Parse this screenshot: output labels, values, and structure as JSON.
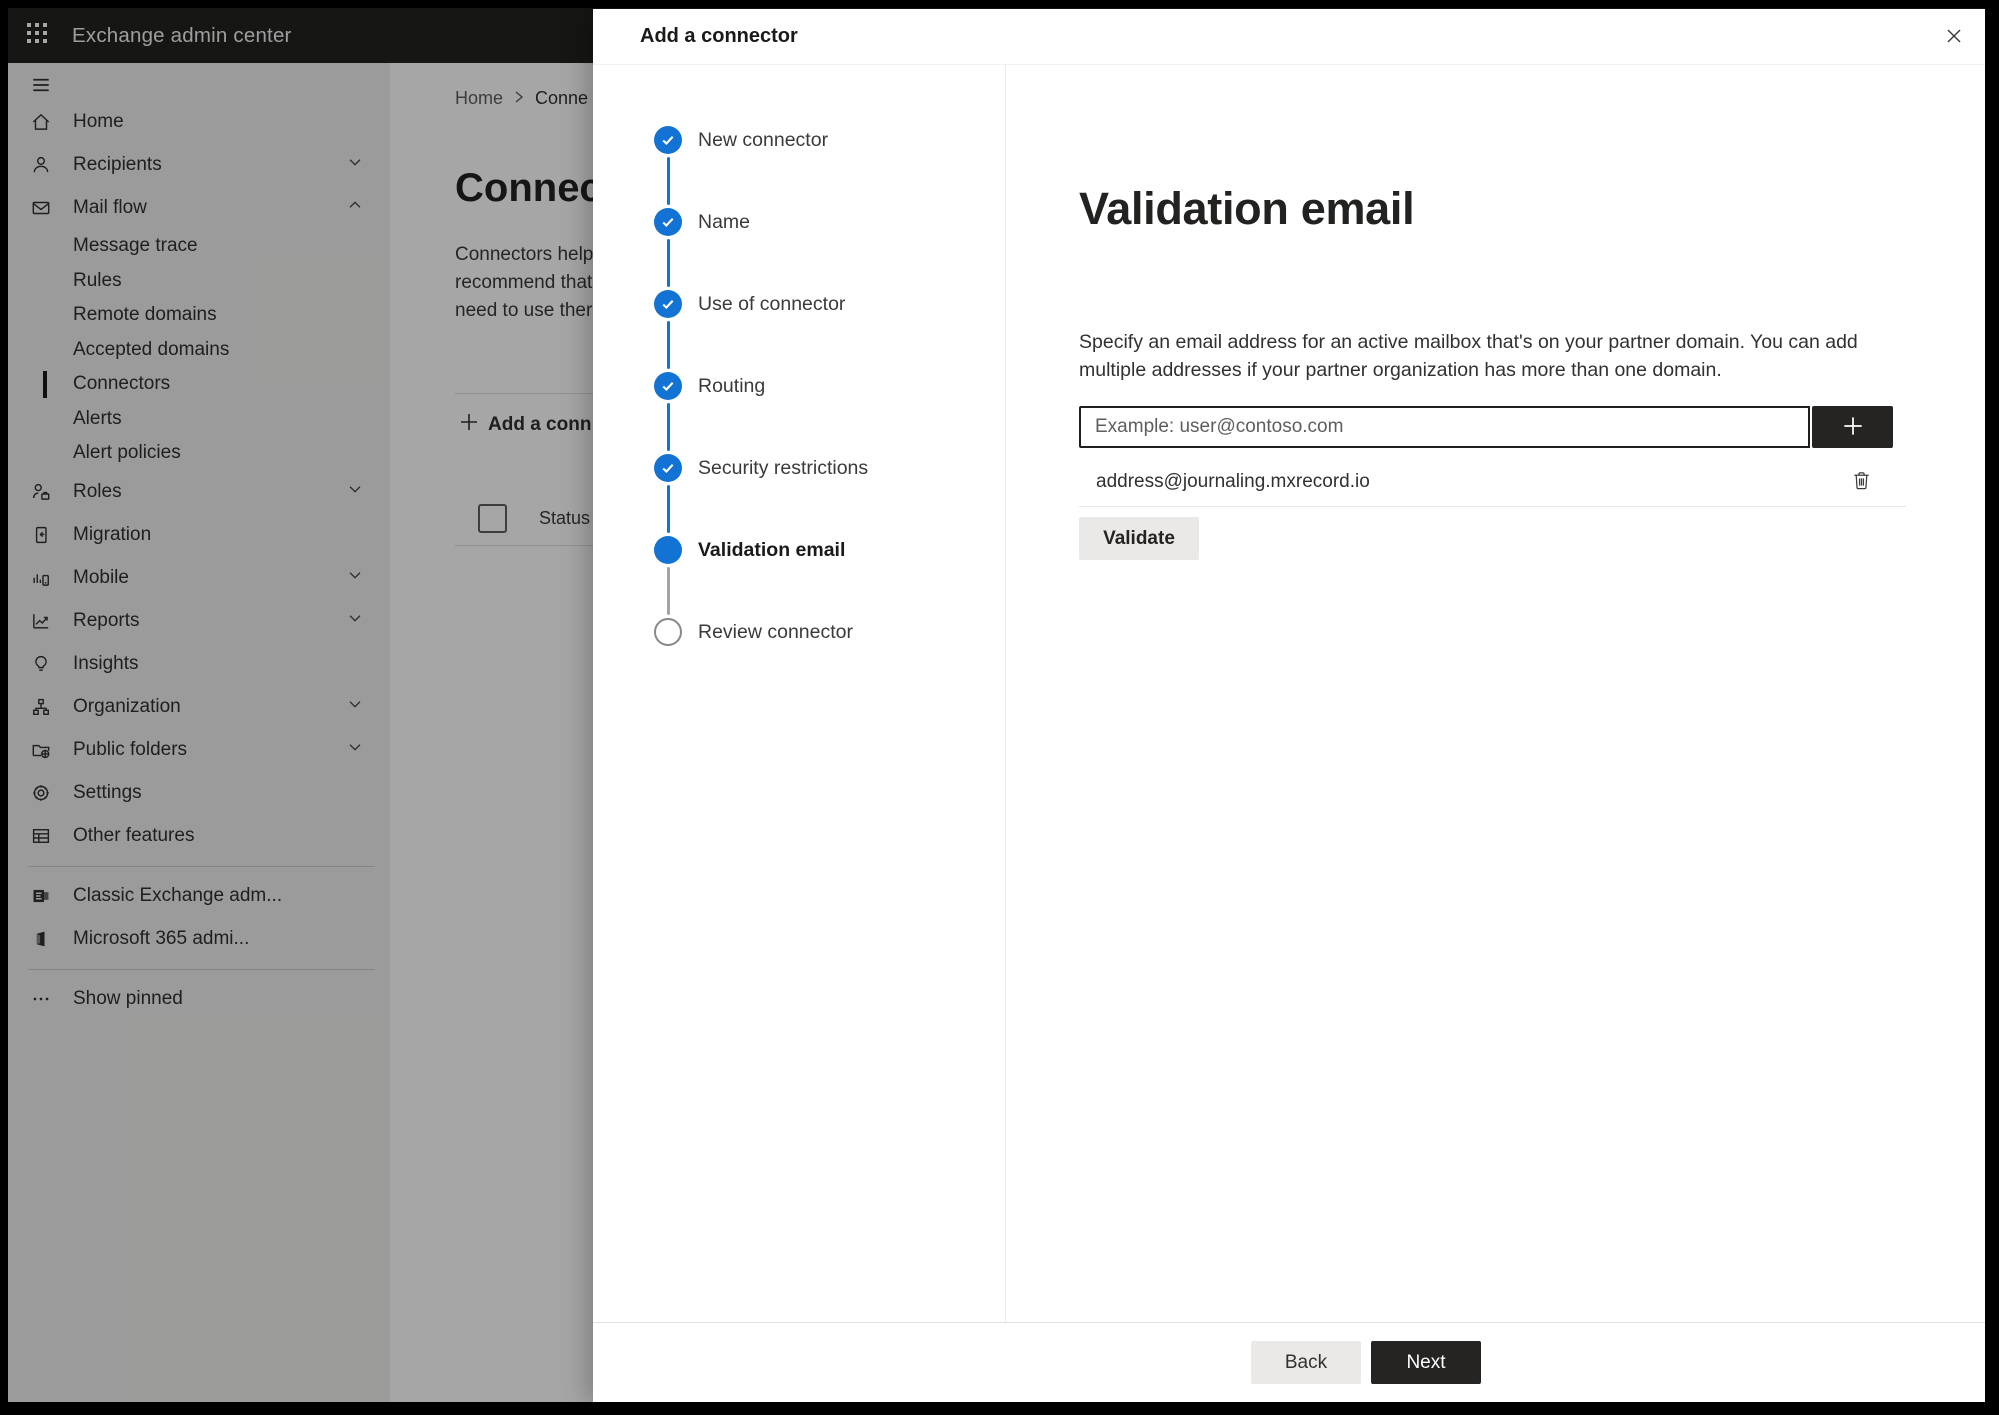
{
  "top_bar": {
    "title": "Exchange admin center",
    "app_launcher_icon": "apps-grid-icon"
  },
  "sidebar": {
    "hamburger_icon": "hamburger-icon",
    "items": [
      {
        "type": "main",
        "label": "Home",
        "icon": "home-icon"
      },
      {
        "type": "main",
        "label": "Recipients",
        "icon": "person-icon",
        "chevron": "down"
      },
      {
        "type": "main",
        "label": "Mail flow",
        "icon": "mail-icon",
        "chevron": "up"
      },
      {
        "type": "sub",
        "label": "Message trace"
      },
      {
        "type": "sub",
        "label": "Rules"
      },
      {
        "type": "sub",
        "label": "Remote domains"
      },
      {
        "type": "sub",
        "label": "Accepted domains"
      },
      {
        "type": "sub",
        "label": "Connectors",
        "selected": true
      },
      {
        "type": "sub",
        "label": "Alerts"
      },
      {
        "type": "sub",
        "label": "Alert policies"
      },
      {
        "type": "main",
        "label": "Roles",
        "icon": "roles-icon",
        "chevron": "down"
      },
      {
        "type": "main",
        "label": "Migration",
        "icon": "migration-icon"
      },
      {
        "type": "main",
        "label": "Mobile",
        "icon": "mobile-icon",
        "chevron": "down"
      },
      {
        "type": "main",
        "label": "Reports",
        "icon": "reports-icon",
        "chevron": "down"
      },
      {
        "type": "main",
        "label": "Insights",
        "icon": "insights-icon"
      },
      {
        "type": "main",
        "label": "Organization",
        "icon": "organization-icon",
        "chevron": "down"
      },
      {
        "type": "main",
        "label": "Public folders",
        "icon": "public-folders-icon",
        "chevron": "down"
      },
      {
        "type": "main",
        "label": "Settings",
        "icon": "settings-icon"
      },
      {
        "type": "main",
        "label": "Other features",
        "icon": "other-features-icon"
      },
      {
        "type": "divider"
      },
      {
        "type": "main",
        "label": "Classic Exchange adm...",
        "icon": "classic-exchange-icon"
      },
      {
        "type": "main",
        "label": "Microsoft 365 admi...",
        "icon": "microsoft-365-icon"
      },
      {
        "type": "divider"
      },
      {
        "type": "main",
        "label": "Show pinned",
        "icon": "more-icon"
      }
    ]
  },
  "background_page": {
    "breadcrumb": {
      "home": "Home",
      "current": "Conne"
    },
    "heading": "Connec",
    "intro_lines": [
      "Connectors help",
      "recommend that",
      "need to use ther"
    ],
    "add_connector_label": "Add a conn",
    "table": {
      "status_header": "Status"
    }
  },
  "dialog": {
    "title": "Add a connector",
    "steps": [
      {
        "label": "New connector",
        "state": "completed"
      },
      {
        "label": "Name",
        "state": "completed"
      },
      {
        "label": "Use of connector",
        "state": "completed"
      },
      {
        "label": "Routing",
        "state": "completed"
      },
      {
        "label": "Security restrictions",
        "state": "completed"
      },
      {
        "label": "Validation email",
        "state": "current"
      },
      {
        "label": "Review connector",
        "state": "upcoming"
      }
    ],
    "content": {
      "heading": "Validation email",
      "description": "Specify an email address for an active mailbox that's on your partner domain. You can add multiple addresses if your partner organization has more than one domain.",
      "email_input": {
        "value": "",
        "placeholder": "Example: user@contoso.com"
      },
      "addresses": [
        "address@journaling.mxrecord.io"
      ],
      "validate_button_label": "Validate"
    },
    "footer": {
      "back_label": "Back",
      "next_label": "Next"
    }
  },
  "colors": {
    "accent_blue": "#1373d4",
    "step_upcoming_gray": "#8a8886",
    "dark_button": "#252423",
    "topbar_bg": "#232221"
  }
}
